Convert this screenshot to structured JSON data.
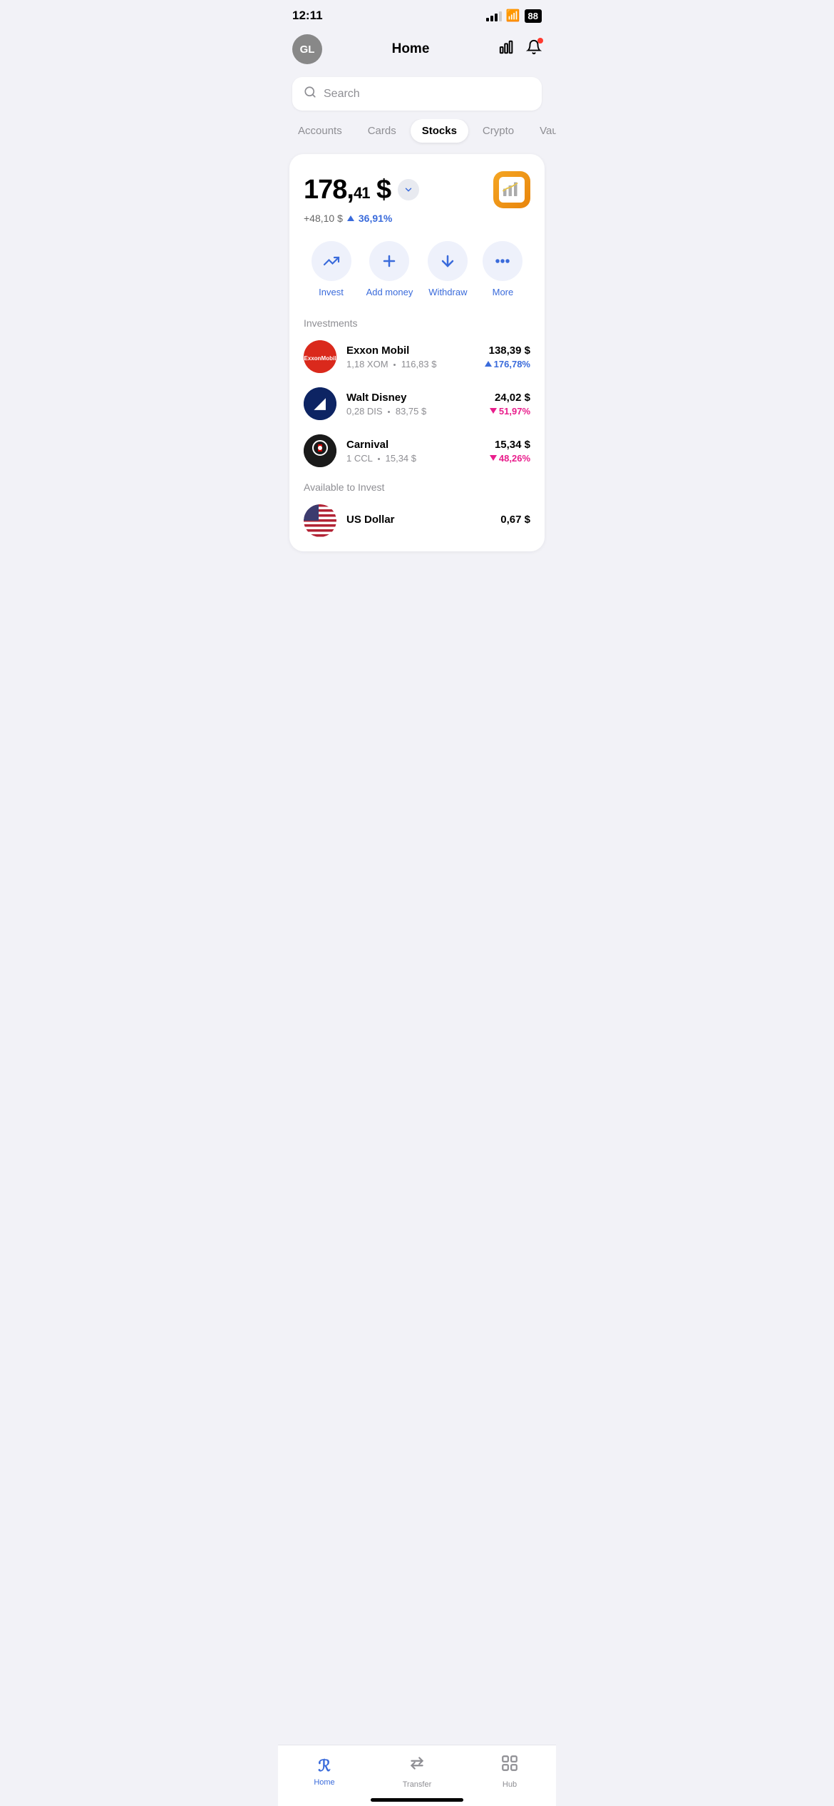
{
  "statusBar": {
    "time": "12:11",
    "battery": "88"
  },
  "header": {
    "avatarInitials": "GL",
    "title": "Home"
  },
  "search": {
    "placeholder": "Search"
  },
  "tabs": [
    {
      "id": "accounts",
      "label": "Accounts",
      "active": false
    },
    {
      "id": "cards",
      "label": "Cards",
      "active": false
    },
    {
      "id": "stocks",
      "label": "Stocks",
      "active": true
    },
    {
      "id": "crypto",
      "label": "Crypto",
      "active": false
    },
    {
      "id": "vaults",
      "label": "Vaults",
      "active": false
    }
  ],
  "portfolio": {
    "balanceWhole": "178,",
    "balanceCents": "41",
    "balanceCurrency": "$",
    "changeAmount": "+48,10 $",
    "changePct": "36,91%",
    "changeDirection": "up"
  },
  "actions": [
    {
      "id": "invest",
      "label": "Invest",
      "icon": "📈"
    },
    {
      "id": "add-money",
      "label": "Add money",
      "icon": "+"
    },
    {
      "id": "withdraw",
      "label": "Withdraw",
      "icon": "↓"
    },
    {
      "id": "more",
      "label": "More",
      "icon": "···"
    }
  ],
  "investmentsLabel": "Investments",
  "investments": [
    {
      "id": "exxon",
      "name": "Exxon Mobil",
      "meta1": "1,18 XOM",
      "meta2": "116,83 $",
      "amount": "138,39 $",
      "pct": "176,78%",
      "direction": "up"
    },
    {
      "id": "disney",
      "name": "Walt Disney",
      "meta1": "0,28 DIS",
      "meta2": "83,75 $",
      "amount": "24,02 $",
      "pct": "51,97%",
      "direction": "down"
    },
    {
      "id": "carnival",
      "name": "Carnival",
      "meta1": "1 CCL",
      "meta2": "15,34 $",
      "amount": "15,34 $",
      "pct": "48,26%",
      "direction": "down"
    }
  ],
  "availableLabel": "Available to Invest",
  "availableItems": [
    {
      "id": "usd",
      "name": "US Dollar",
      "amount": "0,67 $"
    }
  ],
  "bottomNav": [
    {
      "id": "home",
      "label": "Home",
      "icon": "R",
      "active": true
    },
    {
      "id": "transfer",
      "label": "Transfer",
      "icon": "⇄",
      "active": false
    },
    {
      "id": "hub",
      "label": "Hub",
      "icon": "⊞",
      "active": false
    }
  ]
}
